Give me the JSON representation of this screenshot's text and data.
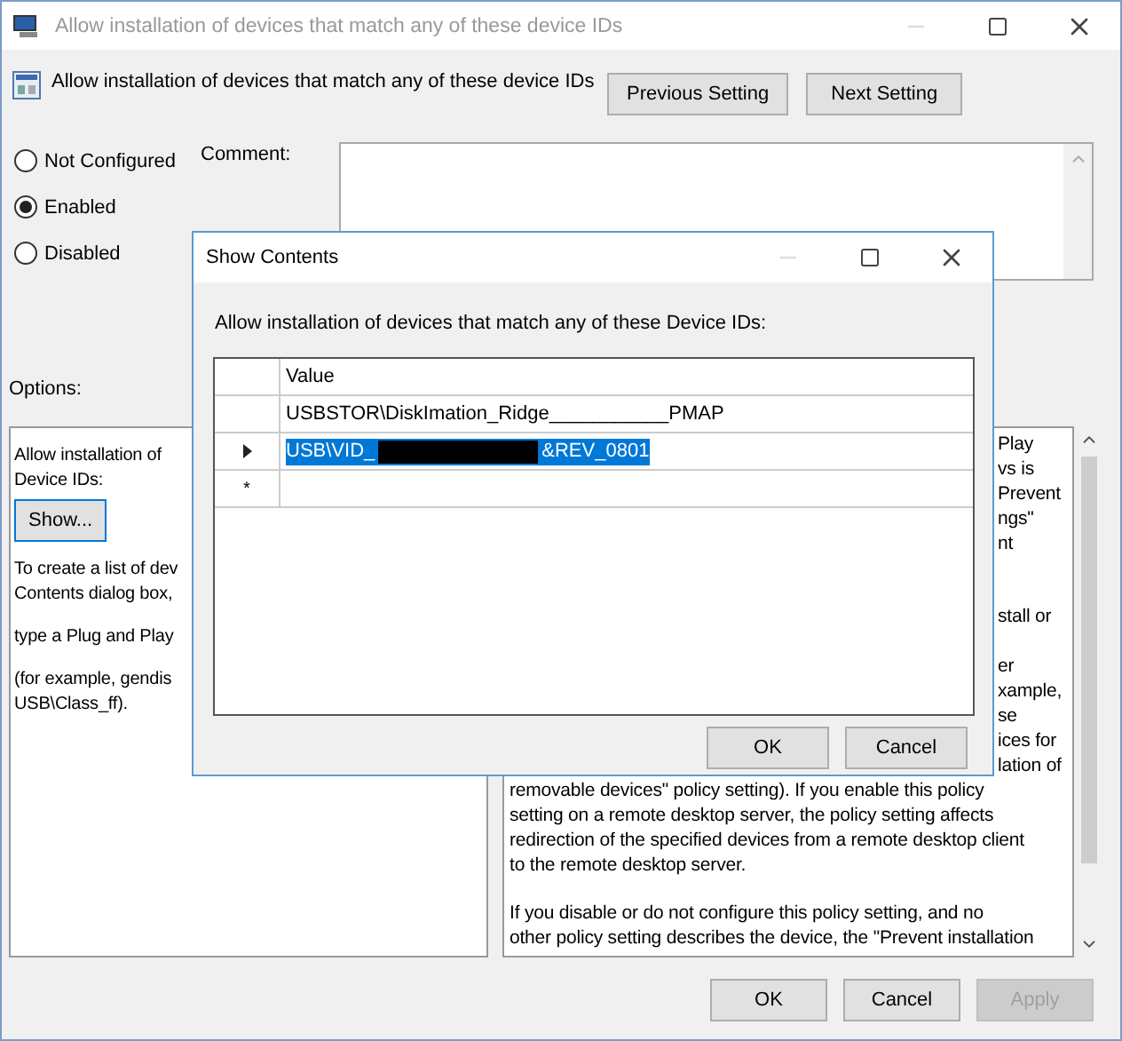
{
  "window": {
    "title": "Allow installation of devices that match any of these device IDs"
  },
  "setting_title": "Allow installation of devices that match any of these device IDs",
  "nav_buttons": [
    {
      "label": "Previous Setting"
    },
    {
      "label": "Next Setting"
    }
  ],
  "state_options": [
    {
      "label": "Not Configured",
      "selected": false
    },
    {
      "label": "Enabled",
      "selected": true
    },
    {
      "label": "Disabled",
      "selected": false
    }
  ],
  "comment": {
    "label": "Comment:"
  },
  "options": {
    "label": "Options:",
    "intro": [
      "Allow installation of",
      "Device IDs:"
    ],
    "button": "Show...",
    "paragraphs": [
      [
        "To create a list of dev",
        "Contents dialog box,"
      ],
      [
        "type a Plug and Play"
      ],
      [
        "(for example, gendis",
        "USB\\Class_ff)."
      ]
    ]
  },
  "help": {
    "fragment_groups": [
      [
        "Play",
        "vs is",
        "Prevent",
        "ngs\"",
        "nt"
      ],
      [
        "stall or"
      ],
      [
        "er",
        "xample,",
        "se",
        "ices for",
        "lation of"
      ]
    ],
    "paragraphs": [
      [
        "removable devices\" policy setting). If you enable this policy",
        "setting on a remote desktop server, the policy setting affects",
        "redirection of the specified devices from a remote desktop client",
        "to the remote desktop server."
      ],
      [
        "If you disable or do not configure this policy setting, and no",
        "other policy setting describes the device, the \"Prevent installation"
      ]
    ]
  },
  "buttons": [
    {
      "label": "OK",
      "disabled": false
    },
    {
      "label": "Cancel",
      "disabled": false
    },
    {
      "label": "Apply",
      "disabled": true
    }
  ],
  "dialog": {
    "title": "Show Contents",
    "prompt": "Allow installation of devices that match any of these Device IDs:",
    "column": "Value",
    "rows": [
      {
        "current": false,
        "selected": false,
        "prefix": "USBSTOR\\DiskImation_Ridge___________PMAP",
        "redacted": false
      },
      {
        "current": true,
        "selected": true,
        "prefix": "USB\\VID_",
        "redacted": true,
        "suffix": "&REV_0801"
      }
    ],
    "new_row": {
      "marker": "*"
    },
    "buttons": [
      {
        "label": "OK"
      },
      {
        "label": "Cancel"
      }
    ]
  }
}
